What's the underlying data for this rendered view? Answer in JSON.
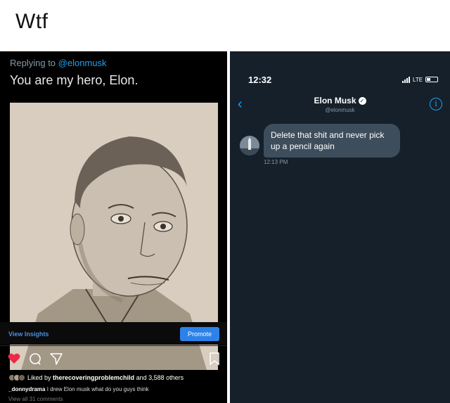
{
  "caption": "Wtf",
  "instagram": {
    "replying_prefix": "Replying to ",
    "replying_handle": "@elonmusk",
    "tweet_text": "You are my hero, Elon.",
    "view_insights": "View Insights",
    "promote": "Promote",
    "liked_by_prefix": "Liked by ",
    "liked_by_user": "therecoveringproblemchild",
    "liked_by_suffix": " and 3,588 others",
    "post_user": "_donnydrama",
    "post_caption": " I drew Elon musk what do you guys think",
    "view_all": "View all 31 comments",
    "icons": [
      "heart-icon",
      "comment-icon",
      "share-icon",
      "bookmark-icon"
    ],
    "accent_color": "#2d82ea"
  },
  "twitter_dm": {
    "status_time": "12:32",
    "network": "LTE",
    "contact_name": "Elon Musk",
    "contact_handle": "@elonmusk",
    "message": "Delete that shit and never pick up a pencil again",
    "message_time": "12:13 PM",
    "accent_color": "#1da1f2"
  }
}
